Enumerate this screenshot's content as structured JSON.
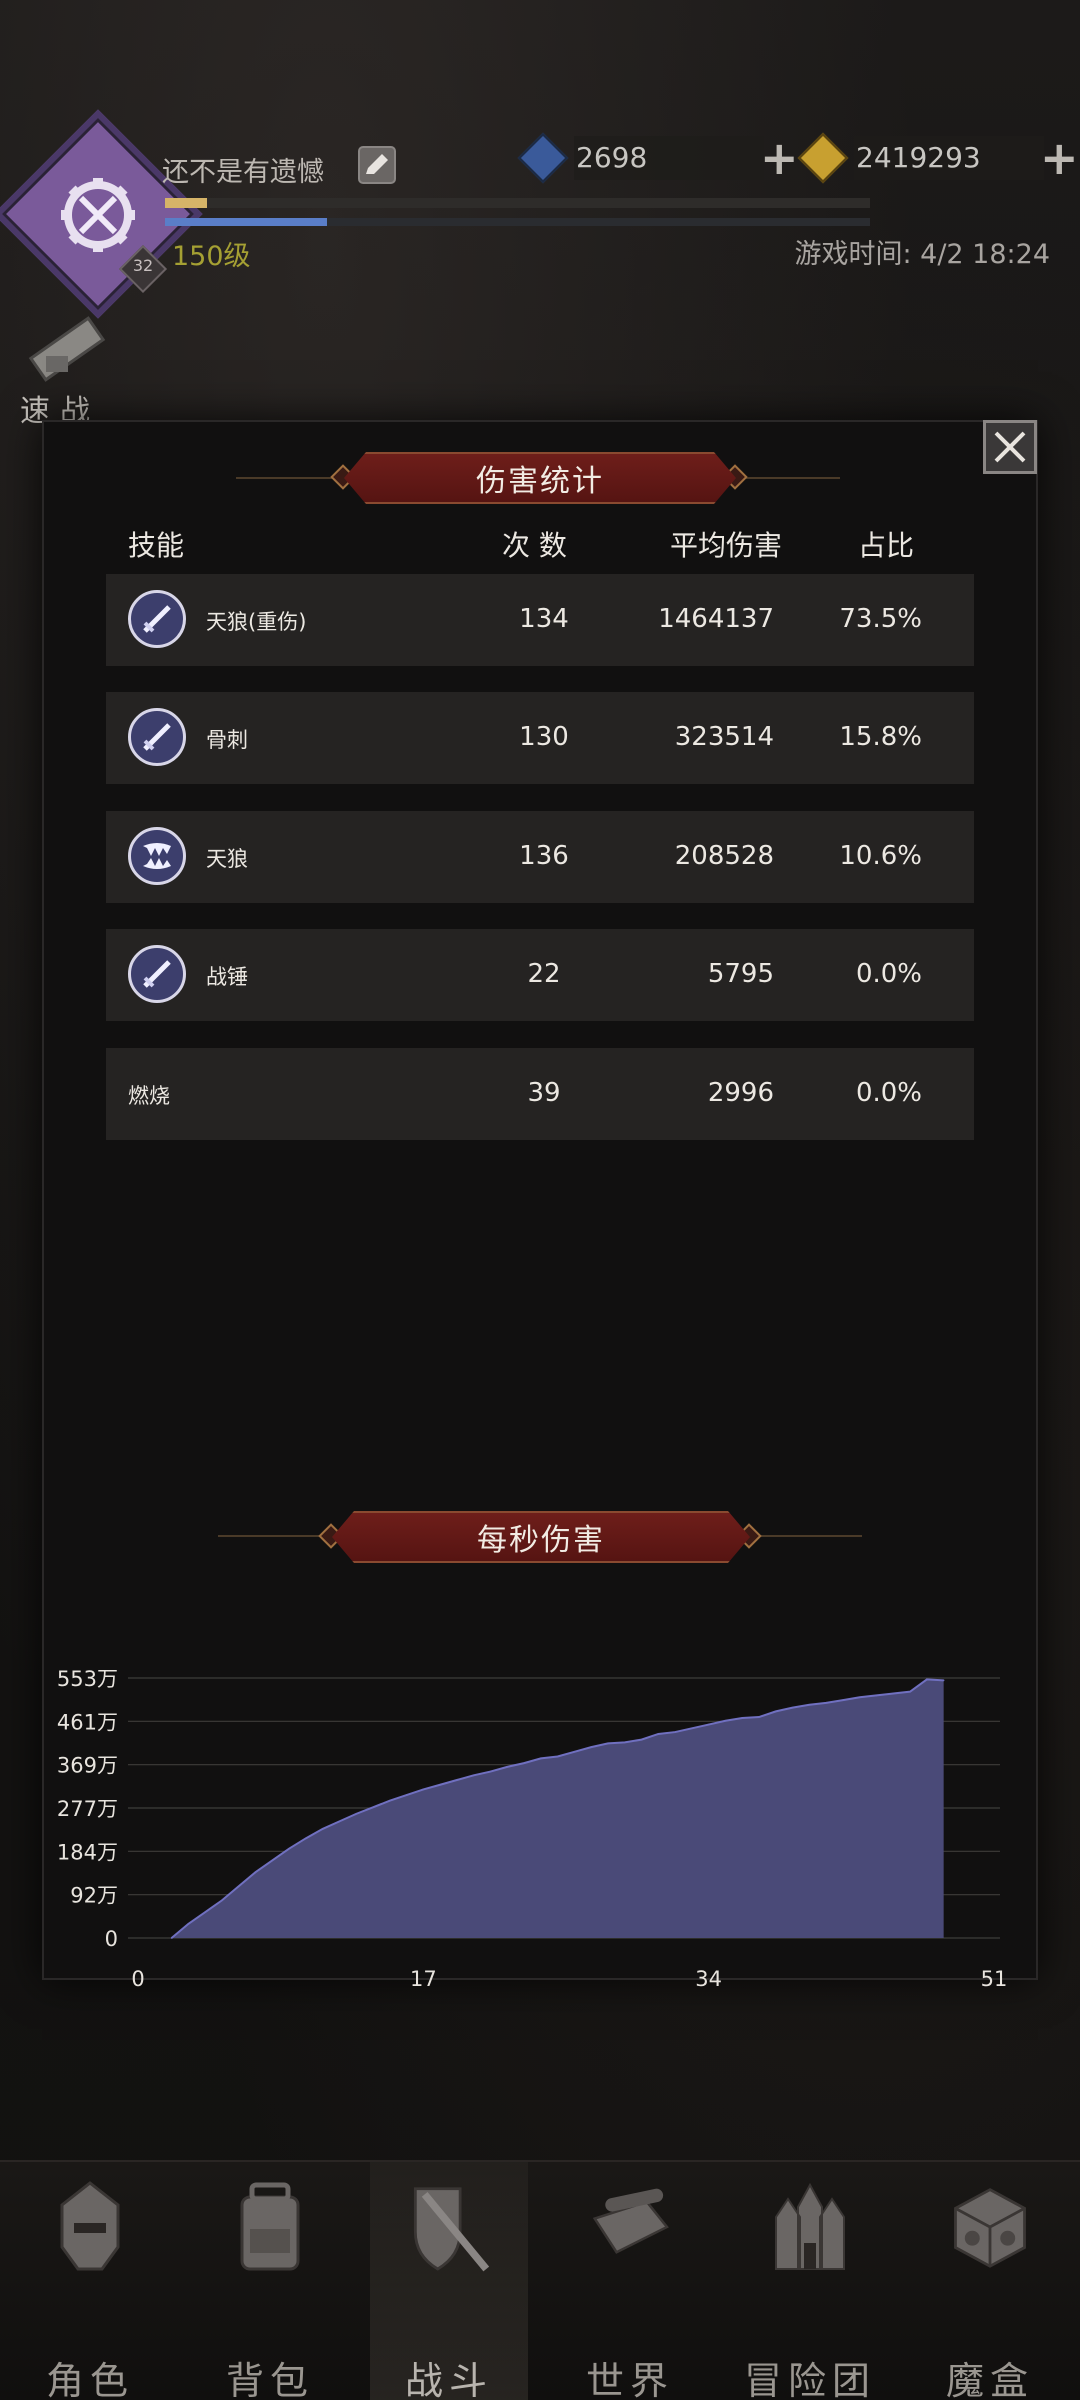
{
  "header": {
    "player_name": "还不是有遗憾",
    "level": "150级",
    "badge_number": "32",
    "exp_fraction_1": 0.06,
    "exp_fraction_2": 0.23,
    "currencies": [
      {
        "name": "blue-gem",
        "amount": "2698",
        "color": "#3a5a9a"
      },
      {
        "name": "gold-gem",
        "amount": "2419293",
        "color": "#c8a030"
      }
    ],
    "game_time": "游戏时间: 4/2 18:24",
    "quick_battle": "速战"
  },
  "dialog": {
    "title": "伤害统计",
    "columns": {
      "skill": "技能",
      "count": "次 数",
      "avg": "平均伤害",
      "pct": "占比"
    },
    "rows": [
      {
        "name": "天狼(重伤)",
        "count": "134",
        "avg": "1464137",
        "pct": "73.5%",
        "icon": "sword-icon"
      },
      {
        "name": "骨刺",
        "count": "130",
        "avg": "323514",
        "pct": "15.8%",
        "icon": "sword-icon"
      },
      {
        "name": "天狼",
        "count": "136",
        "avg": "208528",
        "pct": "10.6%",
        "icon": "fang-icon"
      },
      {
        "name": "战锤",
        "count": "22",
        "avg": "5795",
        "pct": "0.0%",
        "icon": "sword-icon"
      },
      {
        "name": "燃烧",
        "count": "39",
        "avg": "2996",
        "pct": "0.0%",
        "icon": ""
      }
    ],
    "dps_title": "每秒伤害"
  },
  "chart_data": {
    "type": "area",
    "title": "每秒伤害",
    "xlabel": "",
    "ylabel": "",
    "x_ticks": [
      "0",
      "17",
      "34",
      "51"
    ],
    "y_ticks": [
      "0",
      "92万",
      "184万",
      "277万",
      "369万",
      "461万",
      "553万"
    ],
    "xlim": [
      0,
      51
    ],
    "ylim": [
      0,
      553
    ],
    "fill_color": "#4a4a78",
    "line_color": "#7070c0",
    "grid": true,
    "x": [
      2,
      3,
      4,
      5,
      6,
      7,
      8,
      9,
      10,
      11,
      12,
      13,
      14,
      15,
      16,
      17,
      18,
      19,
      20,
      21,
      22,
      23,
      24,
      25,
      26,
      27,
      28,
      29,
      30,
      31,
      32,
      33,
      34,
      35,
      36,
      37,
      38,
      39,
      40,
      41,
      42,
      43,
      44,
      45,
      46,
      47,
      48
    ],
    "y": [
      0,
      30,
      55,
      80,
      110,
      140,
      165,
      190,
      212,
      232,
      248,
      264,
      278,
      292,
      304,
      316,
      326,
      336,
      346,
      354,
      364,
      372,
      382,
      386,
      396,
      406,
      414,
      416,
      422,
      434,
      438,
      446,
      454,
      462,
      468,
      470,
      482,
      490,
      496,
      500,
      506,
      512,
      516,
      520,
      524,
      550,
      548
    ]
  },
  "nav": {
    "items": [
      {
        "label": "角色",
        "icon": "helmet-icon"
      },
      {
        "label": "背包",
        "icon": "backpack-icon"
      },
      {
        "label": "战斗",
        "icon": "shield-sword-icon"
      },
      {
        "label": "世界",
        "icon": "scroll-map-icon"
      },
      {
        "label": "冒险团",
        "icon": "castle-icon"
      },
      {
        "label": "魔盒",
        "icon": "magic-box-icon"
      }
    ],
    "active_index": 2
  }
}
